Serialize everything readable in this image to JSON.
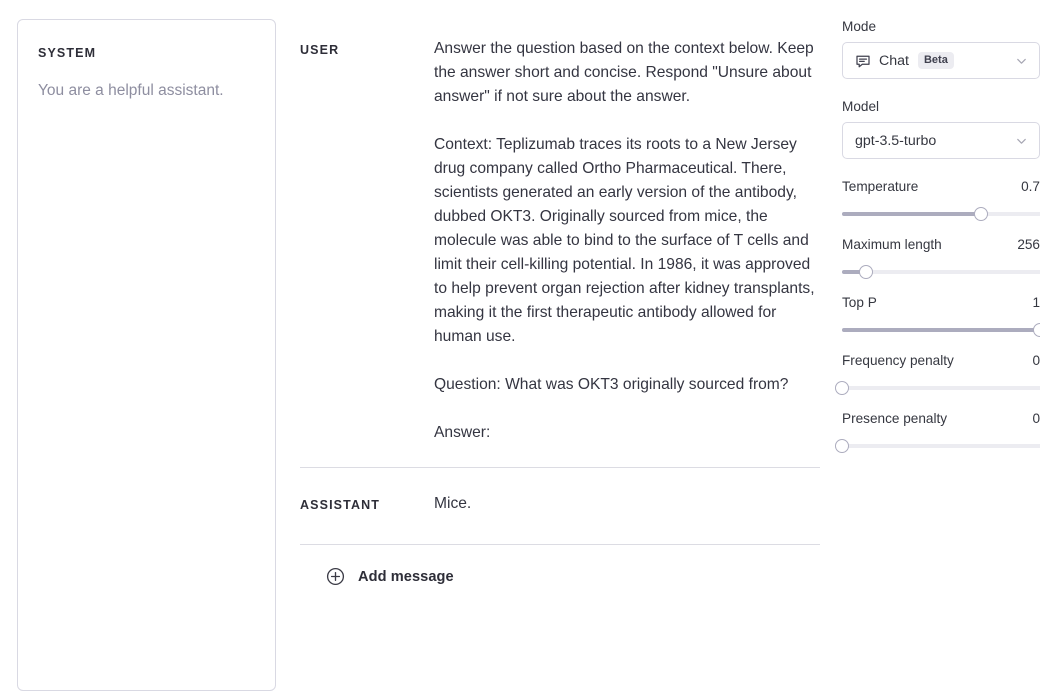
{
  "system": {
    "label": "SYSTEM",
    "text": "You are a helpful assistant."
  },
  "conversation": {
    "user": {
      "role": "USER",
      "text": "Answer the question based on the context below. Keep the answer short and concise. Respond \"Unsure about answer\" if not sure about the answer.\n\nContext: Teplizumab traces its roots to a New Jersey drug company called Ortho Pharmaceutical. There, scientists generated an early version of the antibody, dubbed OKT3. Originally sourced from mice, the molecule was able to bind to the surface of T cells and limit their cell-killing potential. In 1986, it was approved to help prevent organ rejection after kidney transplants, making it the first therapeutic antibody allowed for human use.\n\nQuestion: What was OKT3 originally sourced from?\n\nAnswer:"
    },
    "assistant": {
      "role": "ASSISTANT",
      "text": "Mice."
    },
    "add_message_label": "Add message"
  },
  "settings": {
    "mode": {
      "label": "Mode",
      "value": "Chat",
      "badge": "Beta",
      "icon": "chat-bubble-icon"
    },
    "model": {
      "label": "Model",
      "value": "gpt-3.5-turbo"
    },
    "sliders": [
      {
        "name": "Temperature",
        "value": "0.7",
        "percent": 70
      },
      {
        "name": "Maximum length",
        "value": "256",
        "percent": 12
      },
      {
        "name": "Top P",
        "value": "1",
        "percent": 100
      },
      {
        "name": "Frequency penalty",
        "value": "0",
        "percent": 0
      },
      {
        "name": "Presence penalty",
        "value": "0",
        "percent": 0
      }
    ]
  },
  "colors": {
    "track_fill": "#acacbe",
    "track_bg": "#ececf1",
    "border": "#d9d9e3",
    "text": "#353740",
    "muted": "#8e8ea0"
  }
}
